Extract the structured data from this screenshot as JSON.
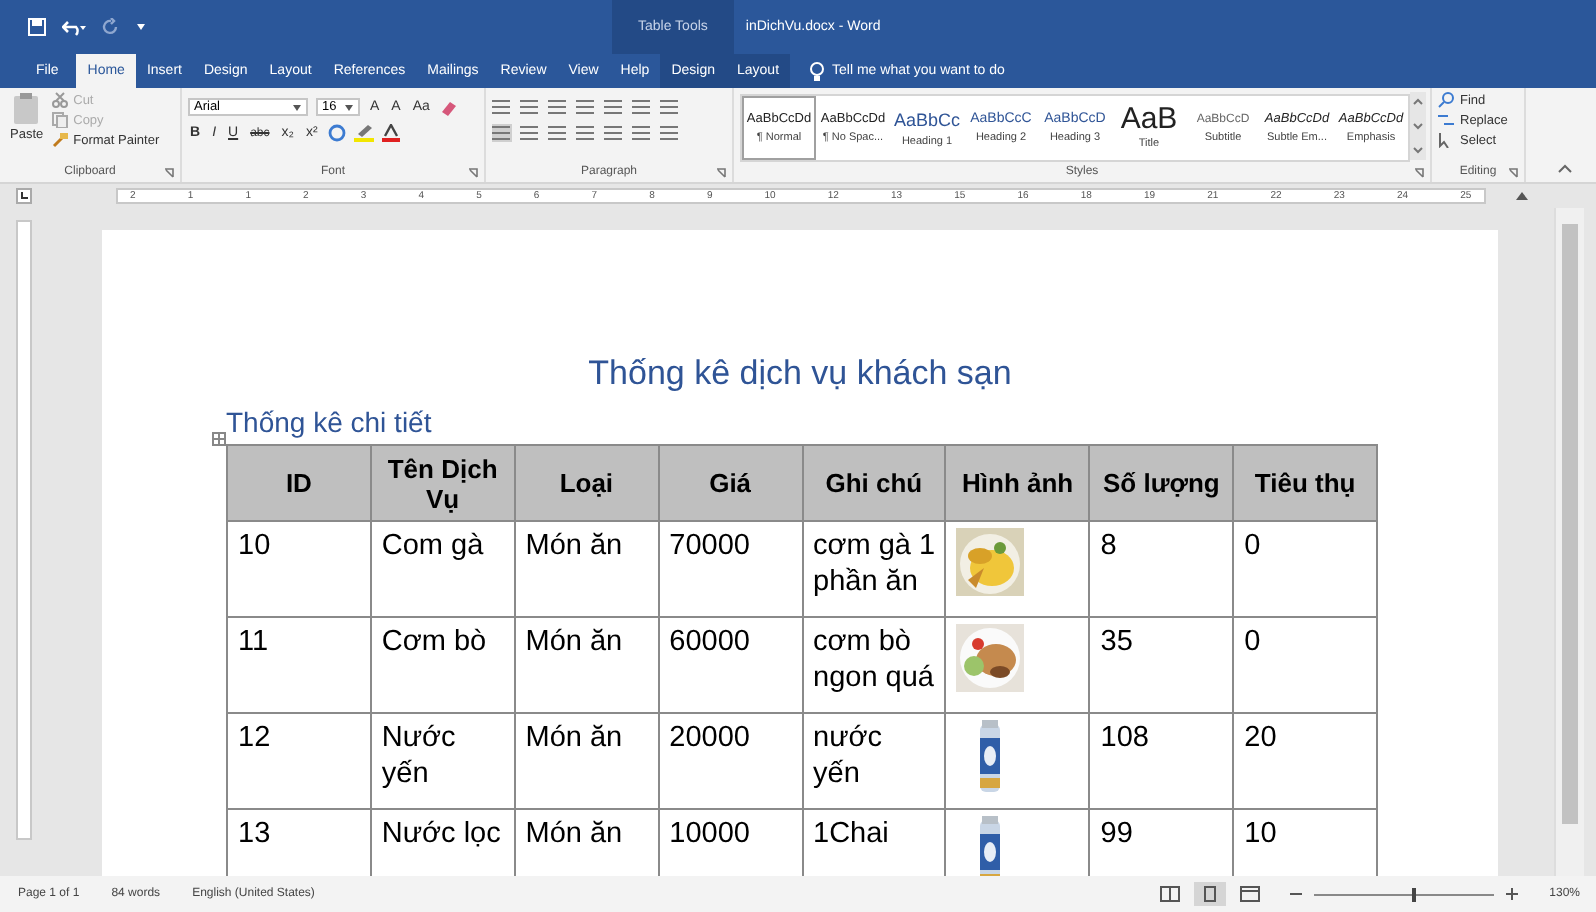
{
  "title_bar": {
    "context_label": "Table Tools",
    "document_title": "inDichVu.docx - Word"
  },
  "tabs": [
    {
      "label": "File",
      "selected": false,
      "kind": "file"
    },
    {
      "label": "Home",
      "selected": true,
      "kind": "normal"
    },
    {
      "label": "Insert",
      "selected": false,
      "kind": "normal"
    },
    {
      "label": "Design",
      "selected": false,
      "kind": "normal"
    },
    {
      "label": "Layout",
      "selected": false,
      "kind": "normal"
    },
    {
      "label": "References",
      "selected": false,
      "kind": "normal"
    },
    {
      "label": "Mailings",
      "selected": false,
      "kind": "normal"
    },
    {
      "label": "Review",
      "selected": false,
      "kind": "normal"
    },
    {
      "label": "View",
      "selected": false,
      "kind": "normal"
    },
    {
      "label": "Help",
      "selected": false,
      "kind": "normal"
    },
    {
      "label": "Design",
      "selected": false,
      "kind": "contextual"
    },
    {
      "label": "Layout",
      "selected": false,
      "kind": "contextual"
    }
  ],
  "tell_me": {
    "placeholder": "Tell me what you want to do"
  },
  "clipboard": {
    "label": "Clipboard",
    "paste": "Paste",
    "commands": [
      {
        "label": "Cut",
        "disabled": true
      },
      {
        "label": "Copy",
        "disabled": true
      },
      {
        "label": "Format Painter",
        "disabled": false
      }
    ]
  },
  "font": {
    "label": "Font",
    "name": "Arial",
    "size": "16",
    "size_buttons": [
      "A",
      "A",
      "Aa"
    ],
    "format_buttons": [
      "B",
      "I",
      "U",
      "abc",
      "x₂",
      "x²"
    ]
  },
  "paragraph": {
    "label": "Paragraph"
  },
  "styles": {
    "label": "Styles",
    "items": [
      {
        "preview": "AaBbCcDd",
        "name": "¶ Normal",
        "selected": true,
        "kind": "body"
      },
      {
        "preview": "AaBbCcDd",
        "name": "¶ No Spac...",
        "selected": false,
        "kind": "body"
      },
      {
        "preview": "AaBbCc",
        "name": "Heading 1",
        "selected": false,
        "kind": "heading1"
      },
      {
        "preview": "AaBbCcC",
        "name": "Heading 2",
        "selected": false,
        "kind": "heading"
      },
      {
        "preview": "AaBbCcD",
        "name": "Heading 3",
        "selected": false,
        "kind": "heading"
      },
      {
        "preview": "AaB",
        "name": "Title",
        "selected": false,
        "kind": "title"
      },
      {
        "preview": "AaBbCcD",
        "name": "Subtitle",
        "selected": false,
        "kind": "subtitle"
      },
      {
        "preview": "AaBbCcDd",
        "name": "Subtle Em...",
        "selected": false,
        "kind": "emphasis"
      },
      {
        "preview": "AaBbCcDd",
        "name": "Emphasis",
        "selected": false,
        "kind": "emphasis"
      }
    ]
  },
  "editing": {
    "label": "Editing",
    "commands": [
      "Find",
      "Replace",
      "Select"
    ]
  },
  "ruler": {
    "marks": [
      "2",
      "1",
      "1",
      "2",
      "3",
      "4",
      "5",
      "6",
      "7",
      "8",
      "9",
      "10",
      "12",
      "13",
      "15",
      "16",
      "18",
      "19",
      "21",
      "22",
      "23",
      "24",
      "25"
    ]
  },
  "document": {
    "title": "Thống kê dịch vụ khách sạn",
    "heading": "Thống kê chi tiết",
    "table": {
      "columns": [
        "ID",
        "Tên Dịch Vụ",
        "Loại",
        "Giá",
        "Ghi chú",
        "Hình ảnh",
        "Số lượng",
        "Tiêu thụ"
      ],
      "rows": [
        {
          "cells": [
            "10",
            "Com gà",
            "Món ăn",
            "70000",
            "cơm gà 1 phần ăn",
            {
              "kind": "picture"
            },
            "8",
            "0"
          ]
        },
        {
          "cells": [
            "11",
            "Cơm bò",
            "Món ăn",
            "60000",
            "cơm bò ngon quá",
            {
              "kind": "picture"
            },
            "35",
            "0"
          ]
        },
        {
          "cells": [
            "12",
            "Nước yến",
            "Món ăn",
            "20000",
            "nước yến",
            {
              "kind": "picture"
            },
            "108",
            "20"
          ]
        },
        {
          "cells": [
            "13",
            "Nước lọc",
            "Món ăn",
            "10000",
            "1Chai",
            {
              "kind": "picture"
            },
            "99",
            "10"
          ]
        }
      ]
    }
  },
  "status_bar": {
    "page": "Page 1 of 1",
    "words": "84 words",
    "language": "English (United States)",
    "zoom": "130%",
    "views": [
      {
        "kind": "read",
        "selected": false
      },
      {
        "kind": "print",
        "selected": true
      },
      {
        "kind": "web",
        "selected": false
      }
    ],
    "zoom_slider": {
      "level": 0.55
    }
  }
}
